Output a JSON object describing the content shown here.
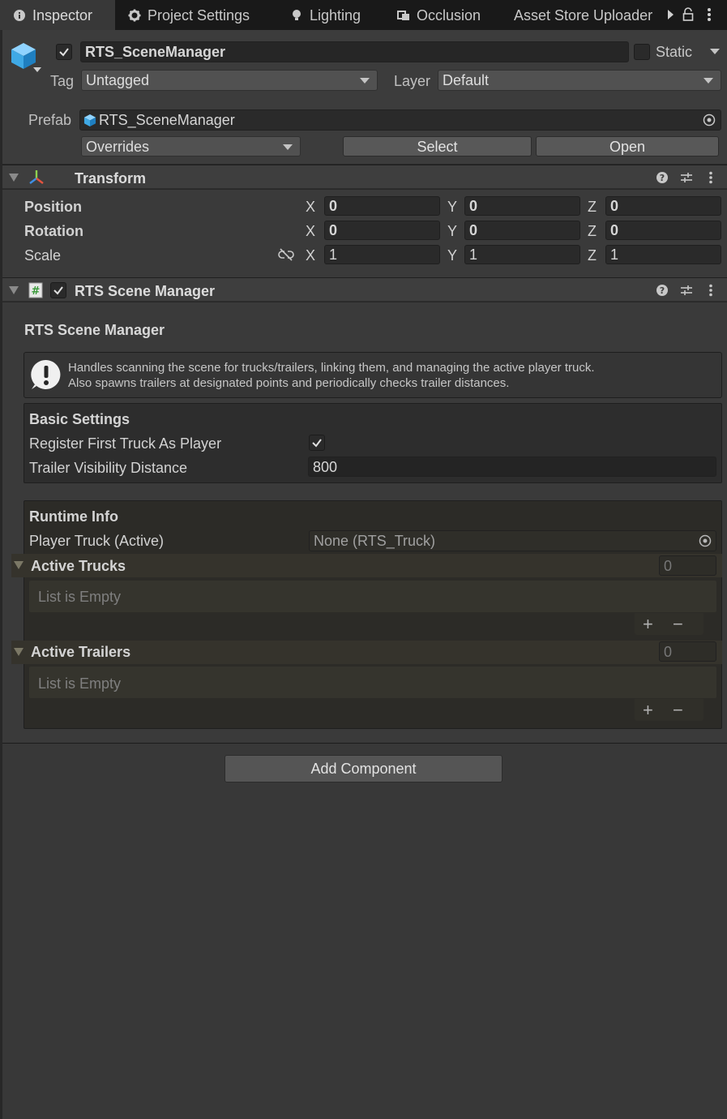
{
  "tabs": [
    {
      "label": "Inspector",
      "icon": "info-icon",
      "active": true
    },
    {
      "label": "Project Settings",
      "icon": "gear-icon",
      "active": false
    },
    {
      "label": "Lighting",
      "icon": "bulb-icon",
      "active": false
    },
    {
      "label": "Occlusion",
      "icon": "occlusion-icon",
      "active": false
    },
    {
      "label": "Asset Store Uploader",
      "icon": "",
      "active": false
    }
  ],
  "header": {
    "object_name": "RTS_SceneManager",
    "active": true,
    "static_label": "Static",
    "static_checked": false,
    "tag_label": "Tag",
    "tag_value": "Untagged",
    "layer_label": "Layer",
    "layer_value": "Default",
    "prefab_label": "Prefab",
    "prefab_value": "RTS_SceneManager",
    "overrides_label": "Overrides",
    "select_label": "Select",
    "open_label": "Open"
  },
  "transform": {
    "title": "Transform",
    "rows": [
      {
        "label": "Position",
        "x": "0",
        "y": "0",
        "z": "0"
      },
      {
        "label": "Rotation",
        "x": "0",
        "y": "0",
        "z": "0"
      },
      {
        "label": "Scale",
        "x": "1",
        "y": "1",
        "z": "1"
      }
    ],
    "axis_x": "X",
    "axis_y": "Y",
    "axis_z": "Z"
  },
  "script_component": {
    "title": "RTS Scene Manager",
    "enabled": true,
    "section_title": "RTS Scene Manager",
    "help_line1": "Handles scanning the scene for trucks/trailers, linking them, and managing the active player truck.",
    "help_line2": "Also spawns trailers at designated points and periodically checks trailer distances.",
    "basic_settings": {
      "title": "Basic Settings",
      "register_label": "Register First Truck As Player",
      "register_checked": true,
      "distance_label": "Trailer Visibility Distance",
      "distance_value": "800"
    },
    "runtime_info": {
      "title": "Runtime Info",
      "player_truck_label": "Player Truck (Active)",
      "player_truck_value": "None (RTS_Truck)",
      "active_trucks_label": "Active Trucks",
      "active_trucks_count": "0",
      "active_trailers_label": "Active Trailers",
      "active_trailers_count": "0",
      "empty_label": "List is Empty",
      "add_symbol": "+",
      "remove_symbol": "−"
    }
  },
  "add_component_label": "Add Component",
  "colors": {
    "accent_blue": "#3fa9e5",
    "background": "#282828"
  }
}
